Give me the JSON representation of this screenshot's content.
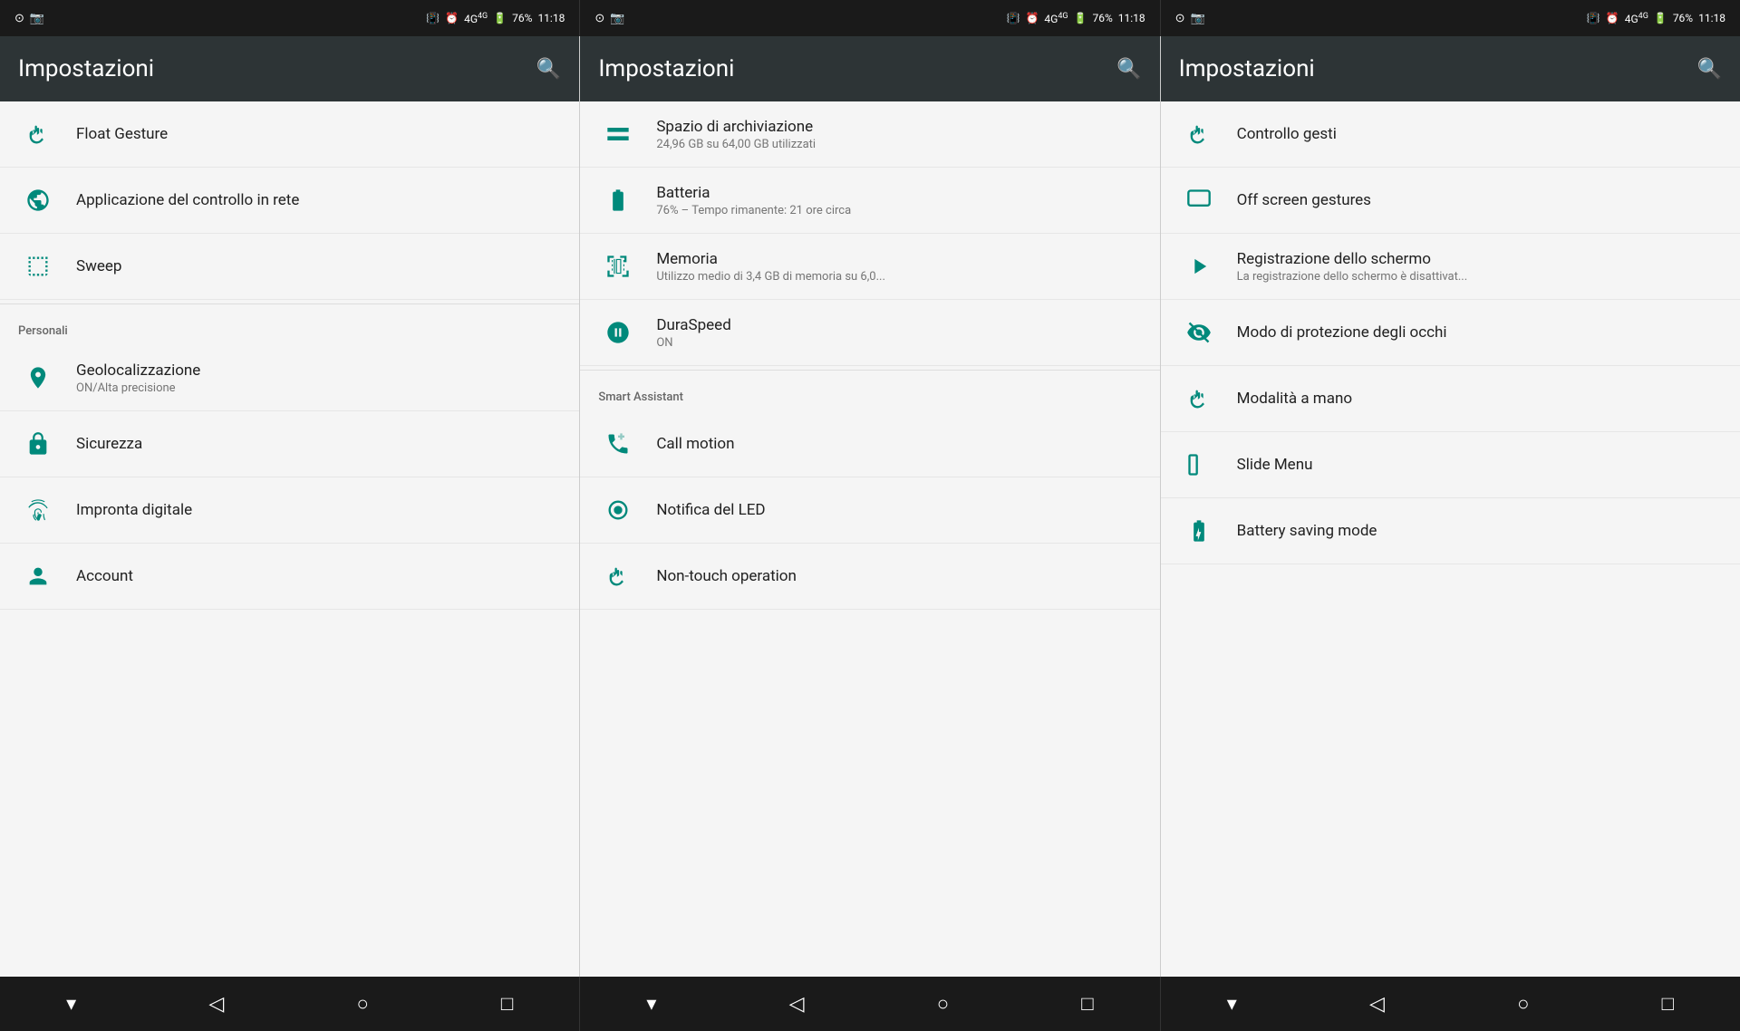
{
  "statusBar": {
    "panels": [
      {
        "id": "panel1",
        "leftIcons": [
          "⊙",
          "📷"
        ],
        "network": "4G",
        "rightIcons": [
          "📳",
          "⏰"
        ],
        "battery": "76%",
        "time": "11:18"
      },
      {
        "id": "panel2",
        "leftIcons": [
          "⊙",
          "📷"
        ],
        "network": "4G",
        "rightIcons": [
          "📳",
          "⏰"
        ],
        "battery": "76%",
        "time": "11:18"
      },
      {
        "id": "panel3",
        "leftIcons": [
          "⊙",
          "📷"
        ],
        "network": "4G",
        "rightIcons": [
          "📳",
          "⏰"
        ],
        "battery": "76%",
        "time": "11:18"
      }
    ]
  },
  "panels": [
    {
      "id": "panel-left",
      "title": "Impostazioni",
      "searchLabel": "search",
      "items": [
        {
          "id": "float-gesture",
          "title": "Float Gesture",
          "subtitle": "",
          "icon": "hand-gesture"
        },
        {
          "id": "app-control-net",
          "title": "Applicazione del controllo in rete",
          "subtitle": "",
          "icon": "globe"
        },
        {
          "id": "sweep",
          "title": "Sweep",
          "subtitle": "",
          "icon": "sweep"
        },
        {
          "id": "section-personal",
          "type": "section",
          "label": "Personali"
        },
        {
          "id": "geolocation",
          "title": "Geolocalizzazione",
          "subtitle": "ON/Alta precisione",
          "icon": "location"
        },
        {
          "id": "security",
          "title": "Sicurezza",
          "subtitle": "",
          "icon": "lock"
        },
        {
          "id": "fingerprint",
          "title": "Impronta digitale",
          "subtitle": "",
          "icon": "fingerprint"
        },
        {
          "id": "account",
          "title": "Account",
          "subtitle": "",
          "icon": "account"
        }
      ]
    },
    {
      "id": "panel-middle",
      "title": "Impostazioni",
      "searchLabel": "search",
      "items": [
        {
          "id": "storage",
          "title": "Spazio di archiviazione",
          "subtitle": "24,96 GB su 64,00 GB utilizzati",
          "icon": "storage"
        },
        {
          "id": "battery",
          "title": "Batteria",
          "subtitle": "76% – Tempo rimanente: 21 ore circa",
          "icon": "battery"
        },
        {
          "id": "memory",
          "title": "Memoria",
          "subtitle": "Utilizzo medio di 3,4 GB di memoria su 6,0...",
          "icon": "memory"
        },
        {
          "id": "duraspeed",
          "title": "DuraSpeed",
          "subtitle": "ON",
          "icon": "duraspeed"
        },
        {
          "id": "section-smart",
          "type": "section",
          "label": "Smart Assistant"
        },
        {
          "id": "call-motion",
          "title": "Call motion",
          "subtitle": "",
          "icon": "call-motion"
        },
        {
          "id": "led-notification",
          "title": "Notifica del LED",
          "subtitle": "",
          "icon": "led"
        },
        {
          "id": "non-touch",
          "title": "Non-touch operation",
          "subtitle": "",
          "icon": "non-touch"
        }
      ]
    },
    {
      "id": "panel-right",
      "title": "Impostazioni",
      "searchLabel": "search",
      "items": [
        {
          "id": "gesture-control",
          "title": "Controllo gesti",
          "subtitle": "",
          "icon": "hand-gesture"
        },
        {
          "id": "off-screen-gestures",
          "title": "Off screen gestures",
          "subtitle": "",
          "icon": "off-screen"
        },
        {
          "id": "screen-recording",
          "title": "Registrazione dello schermo",
          "subtitle": "La registrazione dello schermo è disattivat...",
          "icon": "record-screen"
        },
        {
          "id": "eye-protection",
          "title": "Modo di protezione degli occhi",
          "subtitle": "",
          "icon": "eye-protection"
        },
        {
          "id": "one-hand-mode",
          "title": "Modalità a mano",
          "subtitle": "",
          "icon": "hand"
        },
        {
          "id": "slide-menu",
          "title": "Slide Menu",
          "subtitle": "",
          "icon": "slide-menu"
        },
        {
          "id": "battery-saving",
          "title": "Battery saving mode",
          "subtitle": "",
          "icon": "battery-saving"
        }
      ]
    }
  ],
  "navBar": {
    "buttons": [
      "▾",
      "◁",
      "○",
      "□"
    ]
  }
}
